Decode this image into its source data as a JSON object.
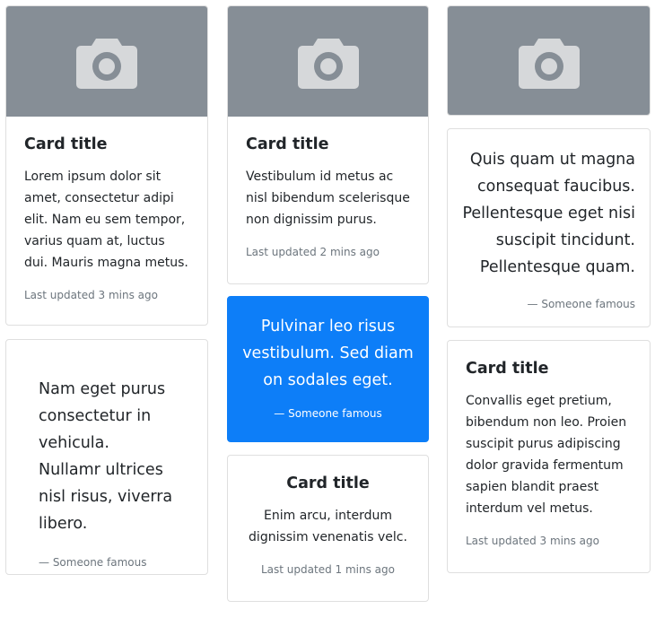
{
  "cards": {
    "c1": {
      "title": "Card title",
      "text": "Lorem ipsum dolor sit amet, consectetur adipi elit. Nam eu sem tempor, varius quam at, luctus dui. Mauris magna metus.",
      "updated": "Last updated 3 mins ago"
    },
    "c2": {
      "text": "Nam eget purus consectetur in vehicula. Nullamr ultrices nisl risus, viverra libero.",
      "footer": "— Someone famous"
    },
    "c3": {
      "title": "Card title",
      "text": "Vestibulum id metus ac nisl bibendum scelerisque non dignissim purus.",
      "updated": "Last updated 2 mins ago"
    },
    "c4": {
      "text": "Pulvinar leo risus vestibulum. Sed diam on sodales eget.",
      "footer": "— Someone famous",
      "bg": "#0d7ef8"
    },
    "c5": {
      "title": "Card title",
      "text": "Enim arcu, interdum dignissim venenatis velc.",
      "updated": "Last updated 1 mins ago"
    },
    "c6": {
      "text": "Quis quam ut magna consequat faucibus. Pellentesque eget nisi suscipit tincidunt. Pellentesque quam.",
      "footer": "— Someone famous"
    },
    "c7": {
      "title": "Card title",
      "text": "Convallis eget pretium, bibendum non leo. Proien suscipit purus adipiscing dolor gravida fermentum sapien blandit praest interdum vel metus.",
      "updated": "Last updated 3 mins ago"
    }
  },
  "icons": {
    "image_placeholder": "camera-icon"
  },
  "colors": {
    "image_bg": "#868e96",
    "camera": "#d6d8da",
    "primary": "#0d7ef8"
  }
}
